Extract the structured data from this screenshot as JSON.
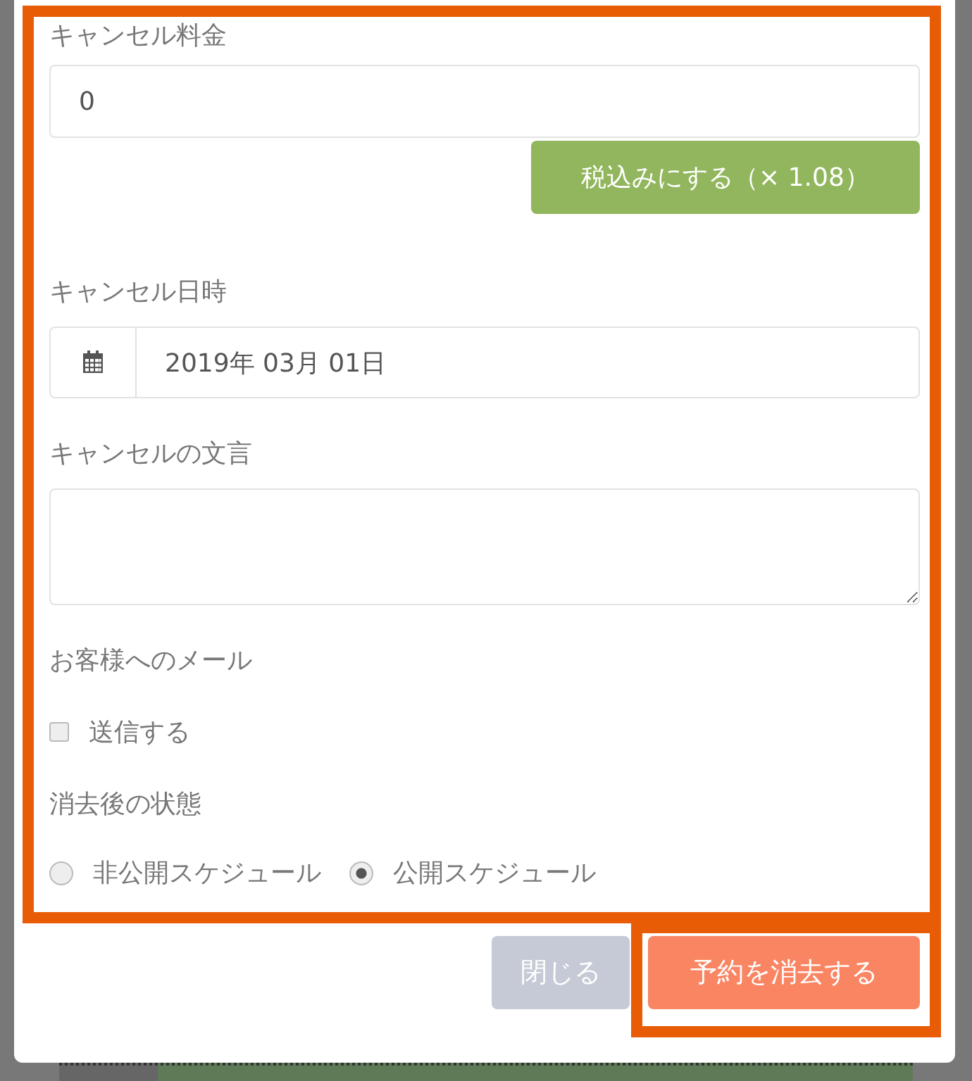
{
  "fields": [
    {
      "kind": "input",
      "label": "キャンセル料金",
      "value": "0",
      "action": "税込みにする（× 1.08）"
    },
    {
      "kind": "date",
      "label": "キャンセル日時",
      "value": "2019年 03月 01日"
    },
    {
      "kind": "textarea",
      "label": "キャンセルの文言"
    },
    {
      "kind": "checkbox",
      "label": "お客様へのメール",
      "option": "送信する",
      "checked": false
    },
    {
      "kind": "radio",
      "label": "消去後の状態",
      "options": [
        {
          "label": "非公開スケジュール",
          "selected": false
        },
        {
          "label": "公開スケジュール",
          "selected": true
        }
      ]
    }
  ],
  "buttons": [
    {
      "label": "閉じる",
      "kind": "secondary"
    },
    {
      "label": "予約を消去する",
      "kind": "danger"
    }
  ]
}
